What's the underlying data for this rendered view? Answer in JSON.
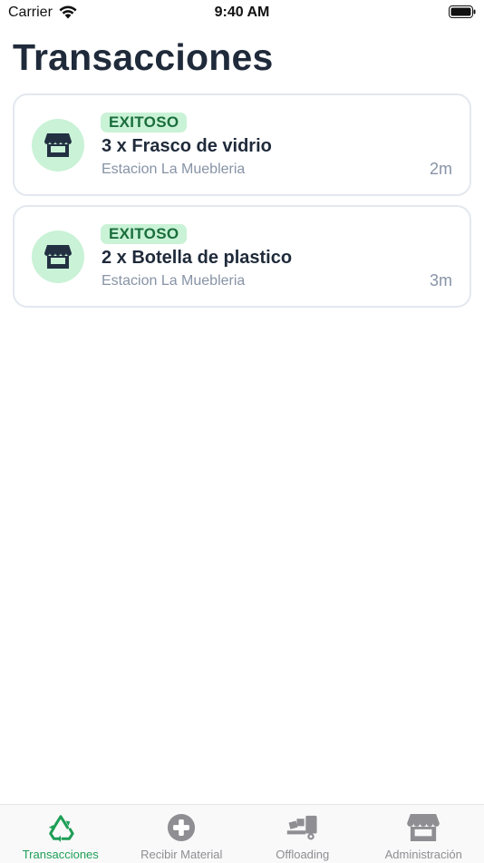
{
  "status_bar": {
    "carrier": "Carrier",
    "time": "9:40 AM"
  },
  "page": {
    "title": "Transacciones"
  },
  "transactions": [
    {
      "status": "EXITOSO",
      "title": "3 x Frasco de vidrio",
      "station": "Estacion La Muebleria",
      "time_ago": "2m",
      "icon": "store-icon"
    },
    {
      "status": "EXITOSO",
      "title": "2 x Botella de plastico",
      "station": "Estacion La Muebleria",
      "time_ago": "3m",
      "icon": "store-icon"
    }
  ],
  "tab_bar": {
    "tabs": [
      {
        "label": "Transacciones",
        "icon": "recycle-icon",
        "active": true
      },
      {
        "label": "Recibir Material",
        "icon": "plus-circle-icon",
        "active": false
      },
      {
        "label": "Offloading",
        "icon": "truck-icon",
        "active": false
      },
      {
        "label": "Administración",
        "icon": "store-icon",
        "active": false
      }
    ]
  },
  "colors": {
    "accent": "#1e9e57",
    "badge_bg": "#c9f2d6",
    "badge_text": "#1a6e3c",
    "title_text": "#1f2a3a",
    "muted_text": "#8793a6",
    "card_border": "#e3e8ef",
    "inactive_tab": "#8e8e93"
  }
}
